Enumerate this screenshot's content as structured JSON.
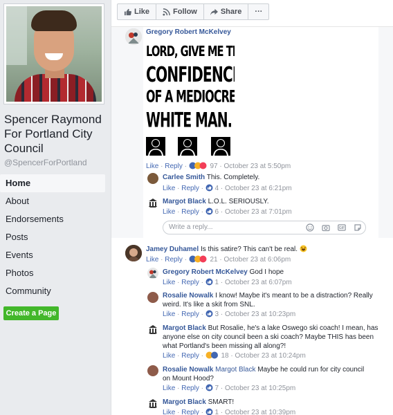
{
  "page": {
    "name": "Spencer Raymond For Portland City Council",
    "handle": "@SpencerForPortland"
  },
  "nav": [
    "Home",
    "About",
    "Endorsements",
    "Posts",
    "Events",
    "Photos",
    "Community"
  ],
  "create_page_label": "Create a Page",
  "actions": {
    "like": "Like",
    "follow": "Follow",
    "share": "Share",
    "more": "···"
  },
  "meme_lines": [
    "LORD, GIVE ME THE",
    "CONFIDENCE",
    "OF A MEDIOCRE",
    "WHITE MAN."
  ],
  "common": {
    "like": "Like",
    "reply": "Reply",
    "sep": " · "
  },
  "comments": [
    {
      "author": "Gregory Robert McKelvey",
      "text": "",
      "count": "97",
      "time": "October 23 at 5:50pm"
    },
    {
      "author": "Carlee Smith",
      "text": "This. Completely.",
      "count": "4",
      "time": "October 23 at 6:21pm"
    },
    {
      "author": "Margot Black",
      "text": "L.O.L. SERIOUSLY.",
      "count": "6",
      "time": "October 23 at 7:01pm"
    },
    {
      "author": "Jamey Duhamel",
      "text": "Is this satire? This can't be real.",
      "count": "21",
      "time": "October 23 at 6:06pm"
    },
    {
      "author": "Gregory Robert McKelvey",
      "text": "God I hope",
      "count": "1",
      "time": "October 23 at 6:07pm"
    },
    {
      "author": "Rosalie Nowalk",
      "text": "I know! Maybe it's meant to be a distraction? Really weird. It's like a skit from SNL.",
      "count": "3",
      "time": "October 23 at 10:23pm"
    },
    {
      "author": "Margot Black",
      "text": "But Rosalie, he's a lake Oswego ski coach! I mean, has anyone else on city council been a ski coach? Maybe THIS has been what Portland's been missing all along?!",
      "count": "18",
      "time": "October 23 at 10:24pm"
    },
    {
      "author": "Rosalie Nowalk",
      "mention": "Margot Black",
      "text": "Maybe he could run for city council on Mount Hood?",
      "count": "7",
      "time": "October 23 at 10:25pm"
    },
    {
      "author": "Margot Black",
      "text": "SMART!",
      "count": "1",
      "time": "October 23 at 10:39pm"
    }
  ],
  "reply_placeholder": "Write a reply...",
  "colors": {
    "link": "#365899",
    "action": "#4267b2",
    "muted": "#90949c",
    "create_btn": "#42b72a"
  }
}
